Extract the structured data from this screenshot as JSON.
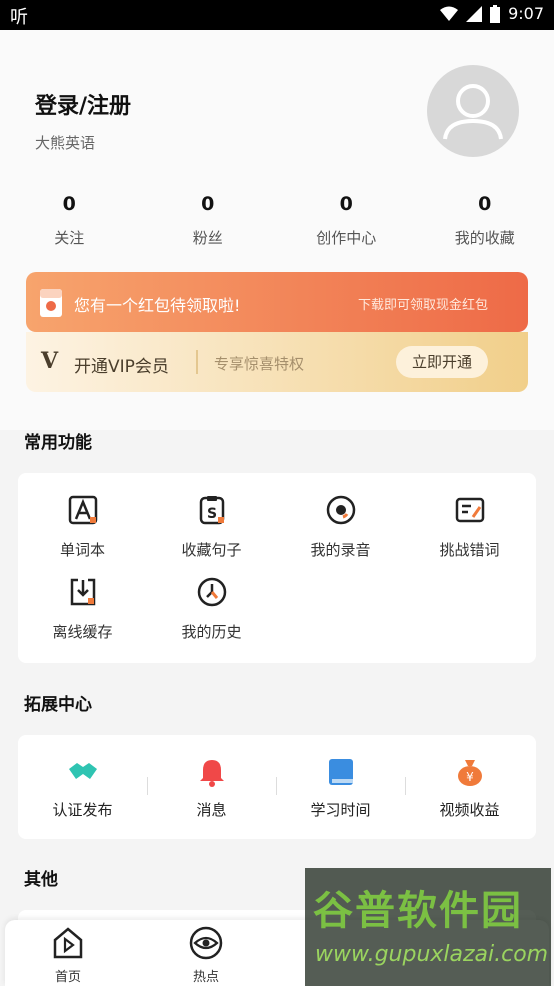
{
  "status_bar": {
    "left_glyph": "听",
    "time": "9:07"
  },
  "profile": {
    "login_label": "登录/注册",
    "app_name": "大熊英语"
  },
  "stats": [
    {
      "count": "0",
      "label": "关注"
    },
    {
      "count": "0",
      "label": "粉丝"
    },
    {
      "count": "0",
      "label": "创作中心"
    },
    {
      "count": "0",
      "label": "我的收藏"
    }
  ],
  "red_packet": {
    "text": "您有一个红包待领取啦!",
    "subtext": "下载即可领取现金红包"
  },
  "vip": {
    "logo": "V",
    "title": "开通VIP会员",
    "subtitle": "专享惊喜特权",
    "button": "立即开通"
  },
  "sections": {
    "common": "常用功能",
    "extension": "拓展中心",
    "other": "其他"
  },
  "common_features": [
    {
      "label": "单词本",
      "icon": "wordbook-icon"
    },
    {
      "label": "收藏句子",
      "icon": "sentence-favorites-icon"
    },
    {
      "label": "我的录音",
      "icon": "recording-icon"
    },
    {
      "label": "挑战错词",
      "icon": "challenge-mistakes-icon"
    },
    {
      "label": "离线缓存",
      "icon": "offline-download-icon"
    },
    {
      "label": "我的历史",
      "icon": "history-icon"
    }
  ],
  "extension_items": [
    {
      "label": "认证发布",
      "icon": "handshake-icon",
      "color": "#2fc4b2"
    },
    {
      "label": "消息",
      "icon": "bell-icon",
      "color": "#f04848"
    },
    {
      "label": "学习时间",
      "icon": "book-icon",
      "color": "#3a8de0"
    },
    {
      "label": "视频收益",
      "icon": "money-bag-icon",
      "color": "#f07a3a"
    }
  ],
  "tab_bar": [
    {
      "label": "首页",
      "icon": "home-play-icon"
    },
    {
      "label": "热点",
      "icon": "eye-icon"
    }
  ],
  "watermark": {
    "line1": "谷普软件园",
    "line2": "www.gupuxlazai.com"
  },
  "colors": {
    "accent_orange": "#ee6a47",
    "vip_gold": "#f1cf8a"
  }
}
